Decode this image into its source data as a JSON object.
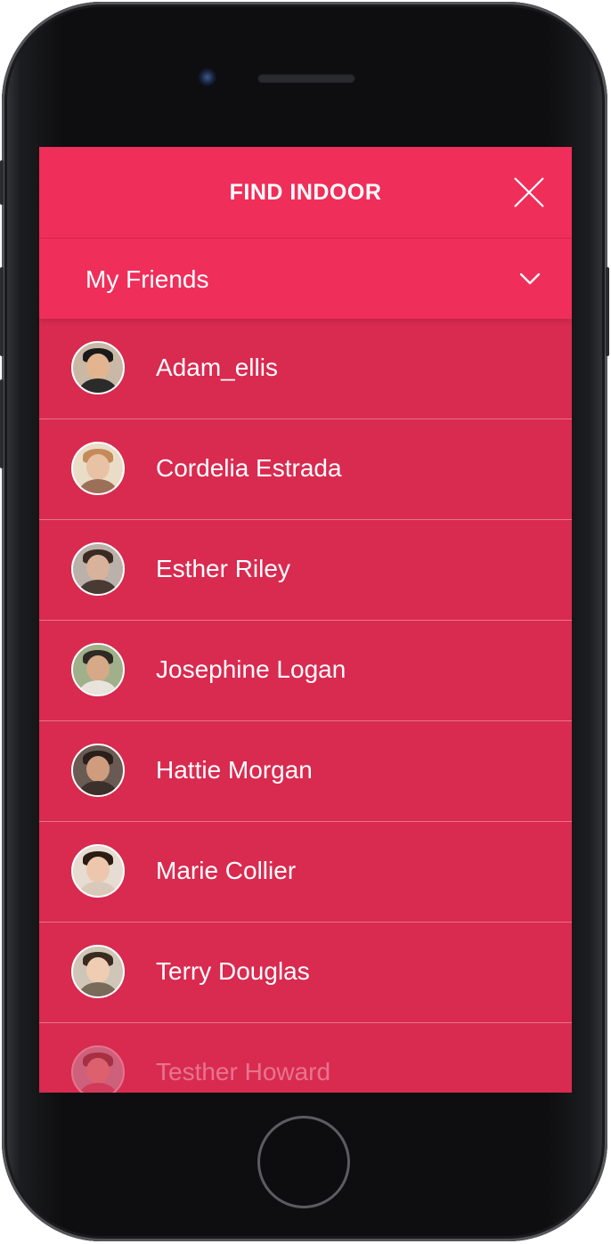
{
  "header": {
    "title": "FIND INDOOR",
    "close_icon": "close-icon"
  },
  "filter": {
    "label": "My Friends",
    "chevron_icon": "chevron-down-icon"
  },
  "friends": [
    {
      "name": "Adam_ellis",
      "avatar_bg": "#c9b8a6",
      "face": "#e2b48f",
      "hair": "#1a1a1a",
      "body": "#2b2b2b"
    },
    {
      "name": "Cordelia Estrada",
      "avatar_bg": "#e9ddc8",
      "face": "#e8c2a4",
      "hair": "#c58a5a",
      "body": "#9c6f58"
    },
    {
      "name": "Esther Riley",
      "avatar_bg": "#b9b1aa",
      "face": "#d9b29c",
      "hair": "#3a2a22",
      "body": "#4a3a34"
    },
    {
      "name": "Josephine Logan",
      "avatar_bg": "#9fb08a",
      "face": "#d6a988",
      "hair": "#2e2a24",
      "body": "#e8e4dc"
    },
    {
      "name": "Hattie Morgan",
      "avatar_bg": "#6a5a54",
      "face": "#cf9d7d",
      "hair": "#2a1f1a",
      "body": "#3c302c"
    },
    {
      "name": "Marie Collier",
      "avatar_bg": "#e6dcd2",
      "face": "#ecc7ad",
      "hair": "#2b1c14",
      "body": "#d9c9bb"
    },
    {
      "name": "Terry Douglas",
      "avatar_bg": "#cfc6b8",
      "face": "#efcdb3",
      "hair": "#3a2a20",
      "body": "#7a6a5a"
    },
    {
      "name": "Testher Howard",
      "avatar_bg": "#b9c4cc",
      "face": "#e6c4aa",
      "hair": "#4a3a2c",
      "body": "#c65a6a"
    }
  ],
  "colors": {
    "header_bg": "#f02e5a",
    "list_bg": "#d92a50",
    "text": "#ffffff"
  }
}
